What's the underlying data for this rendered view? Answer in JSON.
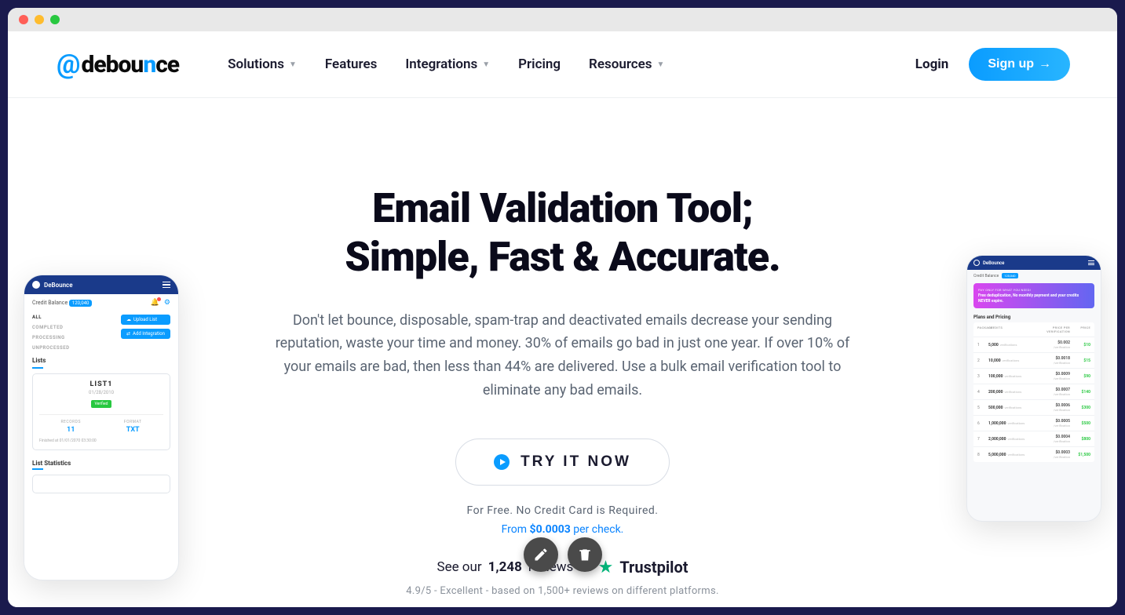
{
  "nav": {
    "items": [
      "Solutions",
      "Features",
      "Integrations",
      "Pricing",
      "Resources"
    ],
    "login": "Login",
    "signup": "Sign up"
  },
  "hero": {
    "headline1": "Email Validation Tool;",
    "headline2": "Simple, Fast & Accurate.",
    "subtext": "Don't let bounce, disposable, spam-trap and deactivated emails decrease your sending reputation, waste your time and money. 30% of emails go bad in just one year. If over 10% of your emails are bad, then less than 44% are delivered. Use a bulk email verification tool to eliminate any bad emails.",
    "cta": "TRY IT NOW",
    "note1": "For Free. No Credit Card is Required.",
    "price_prefix": "From ",
    "price_val": "$0.0003",
    "price_suffix": " per check.",
    "trust_prefix": "See our ",
    "trust_count": "1,248",
    "trust_suffix": " reviews on",
    "trust_brand": "Trustpilot",
    "rating_note": "4.9/5 - Excellent - based on 1,500+ reviews on different platforms."
  },
  "mockLeft": {
    "brand": "DeBounce",
    "credit_label": "Credit Balance",
    "credit_val": "120,040",
    "filters": [
      "ALL",
      "COMPLETED",
      "PROCESSING",
      "UNPROCESSED"
    ],
    "btn_upload": "Upload List",
    "btn_integration": "Add Integration",
    "lists_title": "Lists",
    "card": {
      "title": "LIST1",
      "date": "01/28/2010",
      "badge": "Verified",
      "records_label": "RECORDS",
      "records_val": "11",
      "format_label": "FORMAT",
      "format_val": "TXT",
      "finished": "Finished at 01/01/2070 03:30:00"
    },
    "stats_title": "List Statistics"
  },
  "mockRight": {
    "brand": "DeBounce",
    "credit_label": "Credit Balance",
    "credit_val": "120,040",
    "promo_tag": "PAY ONLY FOR WHAT YOU NEED!",
    "promo_text": "Free deduplication, No monthly payment and your credits NEVER expire.",
    "plans_title": "Plans and Pricing",
    "thead": [
      "PACKAGE",
      "CREDITS",
      "PRICE PER VERIFICATION",
      "PRICE"
    ],
    "rows": [
      {
        "n": "1",
        "credits": "5,000",
        "per": "$0.002",
        "price": "$10"
      },
      {
        "n": "2",
        "credits": "10,000",
        "per": "$0.0018",
        "price": "$15"
      },
      {
        "n": "3",
        "credits": "100,000",
        "per": "$0.0009",
        "price": "$90"
      },
      {
        "n": "4",
        "credits": "200,000",
        "per": "$0.0007",
        "price": "$140"
      },
      {
        "n": "5",
        "credits": "500,000",
        "per": "$0.0006",
        "price": "$300"
      },
      {
        "n": "6",
        "credits": "1,000,000",
        "per": "$0.0005",
        "price": "$500"
      },
      {
        "n": "7",
        "credits": "2,000,000",
        "per": "$0.0004",
        "price": "$800"
      },
      {
        "n": "8",
        "credits": "5,000,000",
        "per": "$0.0003",
        "price": "$1,500"
      }
    ]
  }
}
